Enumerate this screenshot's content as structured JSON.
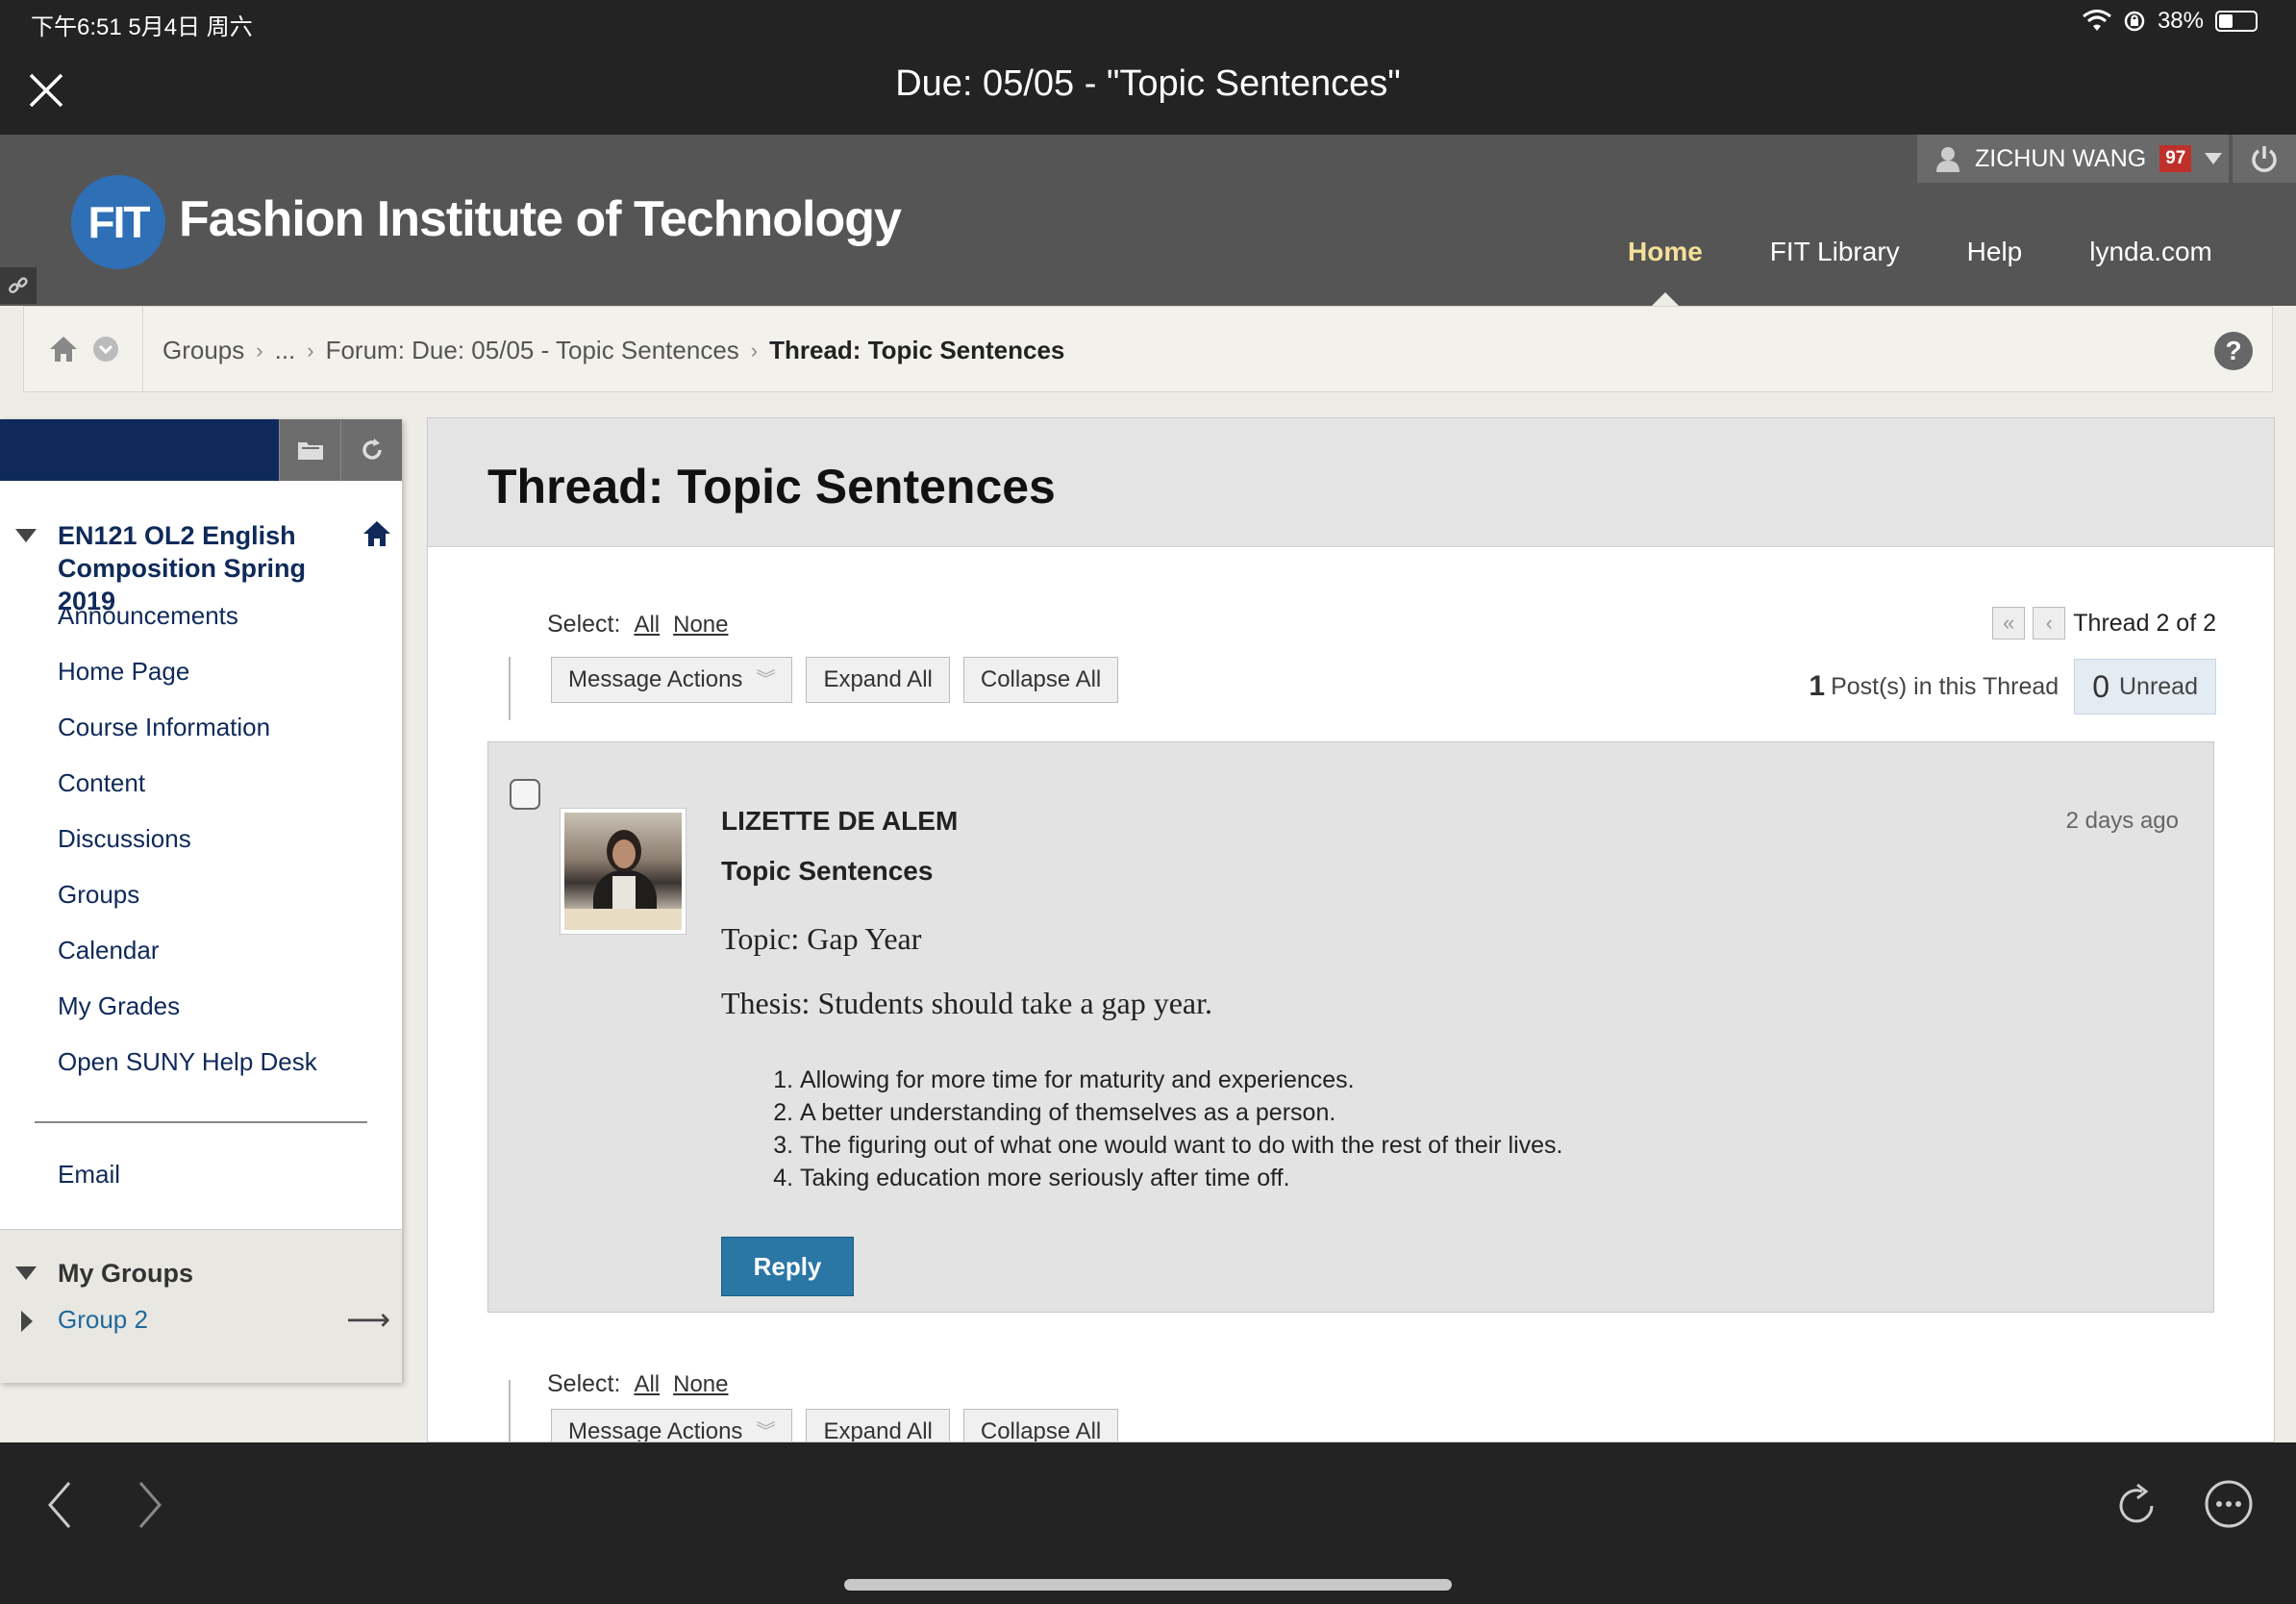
{
  "status_bar": {
    "time": "下午6:51   5月4日 周六",
    "battery": "38%",
    "battery_level": 0.38
  },
  "title_bar": {
    "title": "Due: 05/05 - \"Topic Sentences\""
  },
  "header": {
    "logo_mark": "FIT",
    "logo_text": "Fashion Institute of Technology",
    "user_name": "ZICHUN WANG",
    "notification_count": "97",
    "nav": [
      {
        "label": "Home",
        "active": true
      },
      {
        "label": "FIT Library",
        "active": false
      },
      {
        "label": "Help",
        "active": false
      },
      {
        "label": "lynda.com",
        "active": false
      }
    ]
  },
  "breadcrumb": {
    "items": [
      "Groups",
      "...",
      "Forum: Due: 05/05 - Topic Sentences"
    ],
    "current": "Thread: Topic Sentences",
    "help": "?"
  },
  "sidebar": {
    "course": "EN121 OL2 English Composition Spring 2019",
    "items": [
      "Announcements",
      "Home Page",
      "Course Information",
      "Content",
      "Discussions",
      "Groups",
      "Calendar",
      "My Grades",
      "Open SUNY Help Desk"
    ],
    "email": "Email",
    "my_groups": "My Groups",
    "group": "Group 2"
  },
  "main": {
    "title": "Thread: Topic Sentences",
    "select_label": "Select:",
    "select_all": "All",
    "select_none": "None",
    "message_actions": "Message Actions",
    "expand_all": "Expand All",
    "collapse_all": "Collapse All",
    "thread_position": "Thread 2 of 2",
    "post_count": "1",
    "post_count_label": "Post(s) in this Thread",
    "unread_count": "0",
    "unread_label": "Unread"
  },
  "post": {
    "author": "LIZETTE DE ALEM",
    "time": "2 days ago",
    "subject": "Topic Sentences",
    "topic": "Topic: Gap Year",
    "thesis": "Thesis: Students should take a gap year.",
    "points": [
      "Allowing for more time for maturity and experiences.",
      "A better understanding of themselves as a person.",
      "The figuring out of what one would want to do with the rest of their lives.",
      "Taking education more seriously after time off."
    ],
    "reply": "Reply"
  },
  "colors": {
    "header_bg": "#555555",
    "sidebar_blue": "#0f2a5a",
    "reply_blue": "#2a77a6",
    "active_tab": "#f5e09b",
    "badge_red": "#c0302b"
  }
}
